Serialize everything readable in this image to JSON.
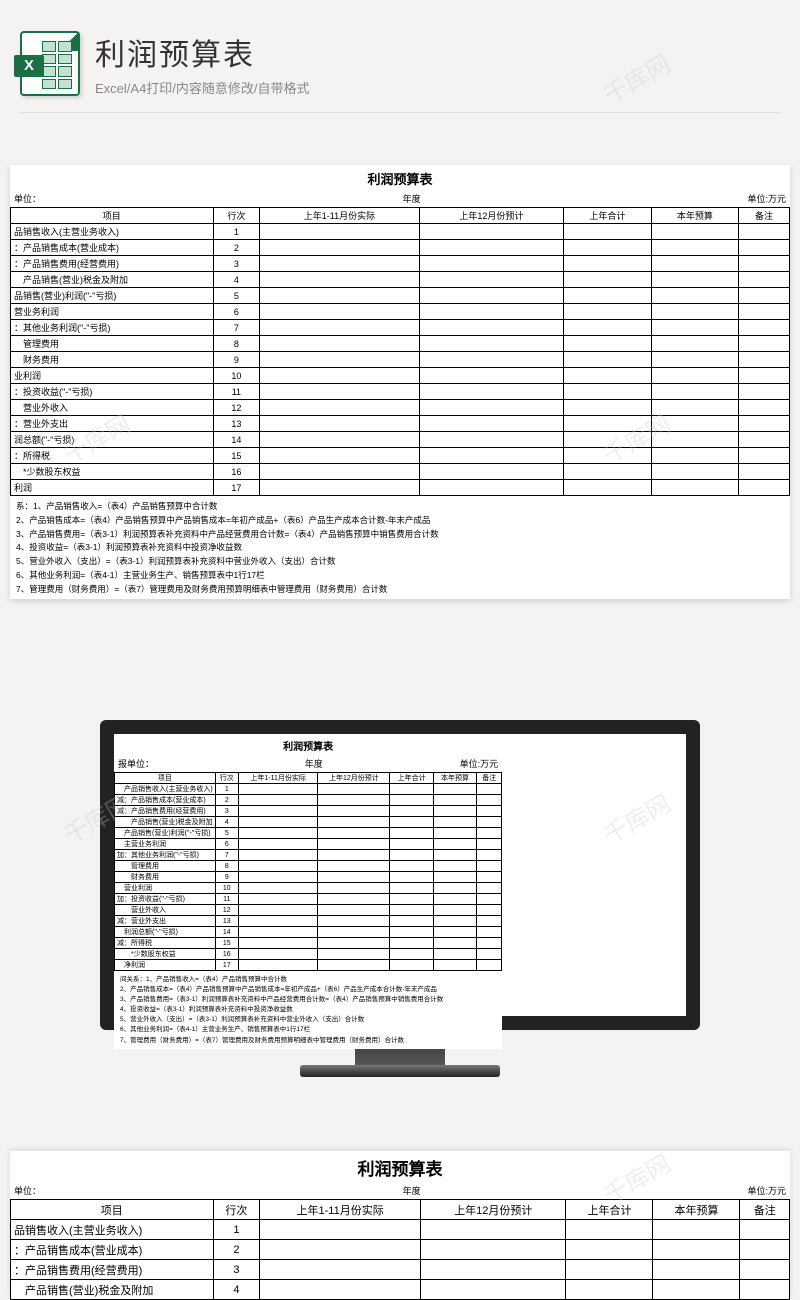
{
  "header": {
    "title": "利润预算表",
    "subtitle": "Excel/A4打印/内容随意修改/自带格式",
    "iconLetter": "X"
  },
  "sheet": {
    "title": "利润预算表",
    "subLeft": "单位：",
    "subCenter": "年度",
    "subRight": "单位:万元",
    "cols": [
      "项目",
      "行次",
      "上年1-11月份实际",
      "上年12月份预计",
      "上年合计",
      "本年预算",
      "备注"
    ],
    "rows": [
      {
        "item": "品销售收入(主营业务收入)",
        "no": "1"
      },
      {
        "item": "：产品销售成本(营业成本)",
        "no": "2"
      },
      {
        "item": "：产品销售费用(经营费用)",
        "no": "3"
      },
      {
        "item": "　产品销售(营业)税金及附加",
        "no": "4"
      },
      {
        "item": "品销售(营业)利润(\"-\"亏损)",
        "no": "5"
      },
      {
        "item": "营业务利润",
        "no": "6"
      },
      {
        "item": "：其他业务利润(\"-\"亏损)",
        "no": "7"
      },
      {
        "item": "　管理费用",
        "no": "8"
      },
      {
        "item": "　财务费用",
        "no": "9"
      },
      {
        "item": "业利润",
        "no": "10"
      },
      {
        "item": "：投资收益(\"-\"亏损)",
        "no": "11"
      },
      {
        "item": "　营业外收入",
        "no": "12"
      },
      {
        "item": "：营业外支出",
        "no": "13"
      },
      {
        "item": "润总额(\"-\"亏损)",
        "no": "14"
      },
      {
        "item": "：所得税",
        "no": "15"
      },
      {
        "item": "　*少数股东权益",
        "no": "16"
      },
      {
        "item": "利润",
        "no": "17"
      }
    ],
    "notesHead": "系：1、产品销售收入=（表4）产品销售预算中合计数",
    "notes": [
      "2、产品销售成本=（表4）产品销售预算中产品销售成本=年初产成品+（表6）产品生产成本合计数-年末产成品",
      "3、产品销售费用=（表3-1）利润预算表补充资料中产品经营费用合计数=（表4）产品销售预算中销售费用合计数",
      "4、投资收益=（表3-1）利润预算表补充资料中投资净收益数",
      "5、营业外收入（支出）=（表3-1）利润预算表补充资料中营业外收入（支出）合计数",
      "6、其他业务利润=（表4-1）主营业务生产、销售预算表中1行17栏",
      "7、管理费用（财务费用）=（表7）管理费用及财务费用预算明细表中管理费用（财务费用）合计数"
    ]
  },
  "sheet2": {
    "subLeft": "报单位：",
    "rows": [
      {
        "item": "　产品销售收入(主营业务收入)",
        "no": "1"
      },
      {
        "item": "减：产品销售成本(营业成本)",
        "no": "2"
      },
      {
        "item": "减：产品销售费用(经营费用)",
        "no": "3"
      },
      {
        "item": "　　产品销售(营业)税金及附加",
        "no": "4"
      },
      {
        "item": "　产品销售(营业)利润(\"-\"亏损)",
        "no": "5"
      },
      {
        "item": "　主营业务利润",
        "no": "6"
      },
      {
        "item": "加：其他业务利润(\"-\"亏损)",
        "no": "7"
      },
      {
        "item": "　　管理费用",
        "no": "8"
      },
      {
        "item": "　　财务费用",
        "no": "9"
      },
      {
        "item": "　营业利润",
        "no": "10"
      },
      {
        "item": "加：投资收益(\"-\"亏损)",
        "no": "11"
      },
      {
        "item": "　　营业外收入",
        "no": "12"
      },
      {
        "item": "减：营业外支出",
        "no": "13"
      },
      {
        "item": "　利润总额(\"-\"亏损)",
        "no": "14"
      },
      {
        "item": "减：所得税",
        "no": "15"
      },
      {
        "item": "　　*少数股东权益",
        "no": "16"
      },
      {
        "item": "　净利润",
        "no": "17"
      }
    ],
    "notesHead": "间关系：1、产品销售收入=（表4）产品销售预算中合计数"
  },
  "watermarks": [
    "千库网",
    "千库网",
    "千库网",
    "千库网",
    "千库网",
    "千库网"
  ]
}
